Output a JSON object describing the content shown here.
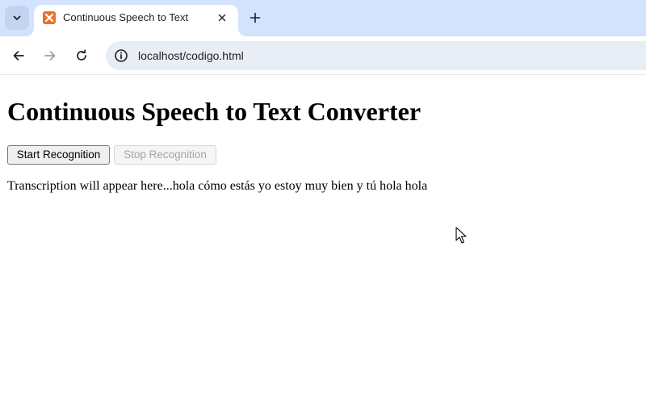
{
  "browser": {
    "tab": {
      "title": "Continuous Speech to Text",
      "favicon": "xampp-icon"
    },
    "address_bar": {
      "url": "localhost/codigo.html"
    }
  },
  "page": {
    "heading": "Continuous Speech to Text Converter",
    "buttons": {
      "start_label": "Start Recognition",
      "stop_label": "Stop Recognition"
    },
    "transcript": "Transcription will appear here...hola cómo estás yo estoy muy bien y tú hola hola"
  },
  "colors": {
    "tabstrip_bg": "#d3e3fd",
    "omnibox_bg": "#e9eef6",
    "favicon_accent": "#e9712e"
  }
}
